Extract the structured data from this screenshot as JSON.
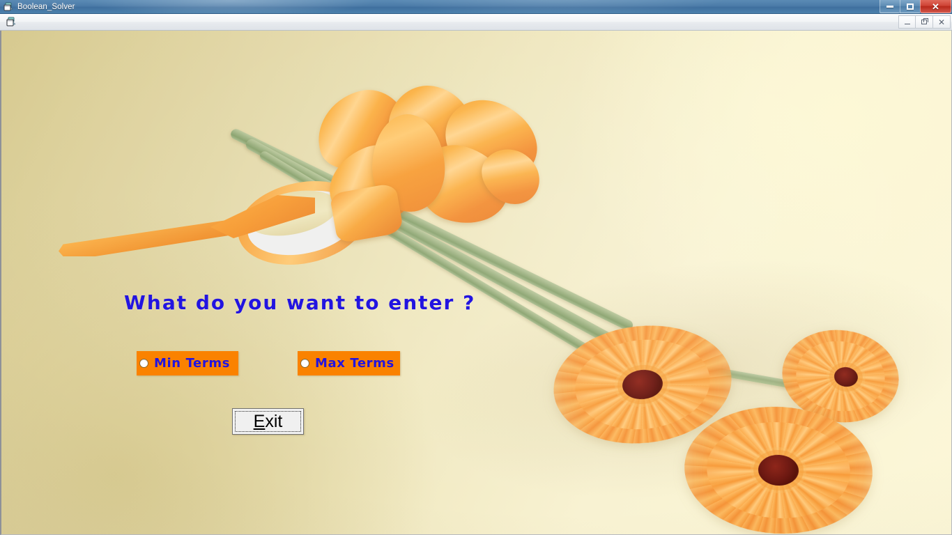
{
  "os_window": {
    "title": "Boolean_Solver",
    "app_icon": "window-stack-icon",
    "controls": {
      "minimize_label": "–",
      "maximize_label": "❐",
      "close_label": "✕"
    }
  },
  "inner_window": {
    "doc_icon": "mdi-document-icon",
    "controls": {
      "minimize_label": "–",
      "restore_label": "❐",
      "close_label": "✕"
    }
  },
  "form": {
    "question": "What do you want to enter ?",
    "options": [
      {
        "id": "min-terms",
        "label": "Min Terms",
        "selected": false
      },
      {
        "id": "max-terms",
        "label": "Max Terms",
        "selected": false
      }
    ],
    "exit_button": {
      "accelerator": "E",
      "rest": "xit"
    }
  },
  "colors": {
    "option_panel_background": "#fa8200",
    "option_text": "#2214e0",
    "question_text": "#2214e0",
    "titlebar_blue": "#4b7ba8",
    "close_red": "#cf4436",
    "canvas_tan": "#d7ca90",
    "canvas_cream": "#fcf7d8"
  },
  "background_image": {
    "description": "orange ribbon bow with green stems and three orange gerbera daisies on a cream background"
  }
}
